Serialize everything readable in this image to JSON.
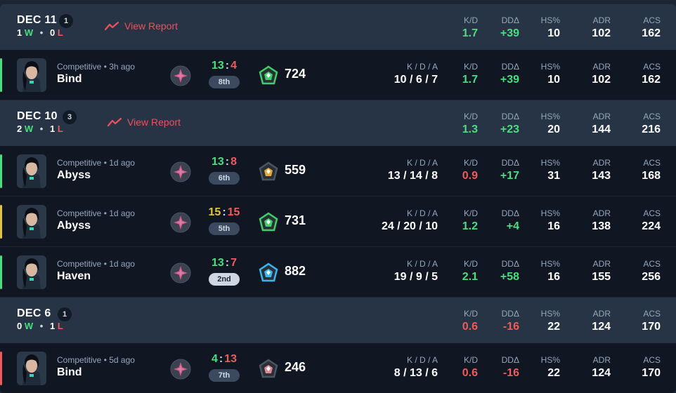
{
  "stat_labels": {
    "kd": "K/D",
    "dd": "DDΔ",
    "hs": "HS%",
    "adr": "ADR",
    "acs": "ACS",
    "kda": "K / D / A"
  },
  "colors": {
    "win": "#4ade80",
    "loss": "#f05a5a",
    "draw": "#e3c542",
    "header_bg": "#263446",
    "row_bg": "#101722"
  },
  "days": [
    {
      "date": "DEC 11",
      "count": "1",
      "wins": "1",
      "win_label": "W",
      "losses": "0",
      "loss_label": "L",
      "view_report": "View Report",
      "kd": "1.7",
      "dd": "+39",
      "hs": "10",
      "adr": "102",
      "acs": "162",
      "matches": [
        {
          "mode": "Competitive • 3h ago",
          "map": "Bind",
          "score_us": "13",
          "score_them": "4",
          "place": "8th",
          "rr": "724",
          "kda": "10 / 6 / 7",
          "kd": "1.7",
          "dd": "+39",
          "hs": "10",
          "adr": "102",
          "acs": "162",
          "result": "win",
          "tier_color": "#3fcf6a"
        }
      ]
    },
    {
      "date": "DEC 10",
      "count": "3",
      "wins": "2",
      "win_label": "W",
      "losses": "1",
      "loss_label": "L",
      "view_report": "View Report",
      "kd": "1.3",
      "dd": "+23",
      "hs": "20",
      "adr": "144",
      "acs": "216",
      "matches": [
        {
          "mode": "Competitive • 1d ago",
          "map": "Abyss",
          "score_us": "13",
          "score_them": "8",
          "place": "6th",
          "rr": "559",
          "kda": "13 / 14 / 8",
          "kd": "0.9",
          "dd": "+17",
          "hs": "31",
          "adr": "143",
          "acs": "168",
          "result": "win",
          "tier_color": "#e0a93a"
        },
        {
          "mode": "Competitive • 1d ago",
          "map": "Abyss",
          "score_us": "15",
          "score_them": "15",
          "place": "5th",
          "rr": "731",
          "kda": "24 / 20 / 10",
          "kd": "1.2",
          "dd": "+4",
          "hs": "16",
          "adr": "138",
          "acs": "224",
          "result": "draw",
          "tier_color": "#3fcf6a"
        },
        {
          "mode": "Competitive • 1d ago",
          "map": "Haven",
          "score_us": "13",
          "score_them": "7",
          "place": "2nd",
          "rr": "882",
          "kda": "19 / 9 / 5",
          "kd": "2.1",
          "dd": "+58",
          "hs": "16",
          "adr": "155",
          "acs": "256",
          "result": "win",
          "tier_color": "#39b6f0"
        }
      ]
    },
    {
      "date": "DEC 6",
      "count": "1",
      "wins": "0",
      "win_label": "W",
      "losses": "1",
      "loss_label": "L",
      "view_report": "",
      "kd": "0.6",
      "dd": "-16",
      "hs": "22",
      "adr": "124",
      "acs": "170",
      "matches": [
        {
          "mode": "Competitive • 5d ago",
          "map": "Bind",
          "score_us": "4",
          "score_them": "13",
          "place": "7th",
          "rr": "246",
          "kda": "8 / 13 / 6",
          "kd": "0.6",
          "dd": "-16",
          "hs": "22",
          "adr": "124",
          "acs": "170",
          "result": "loss",
          "tier_color": "#d98a96"
        }
      ]
    }
  ]
}
